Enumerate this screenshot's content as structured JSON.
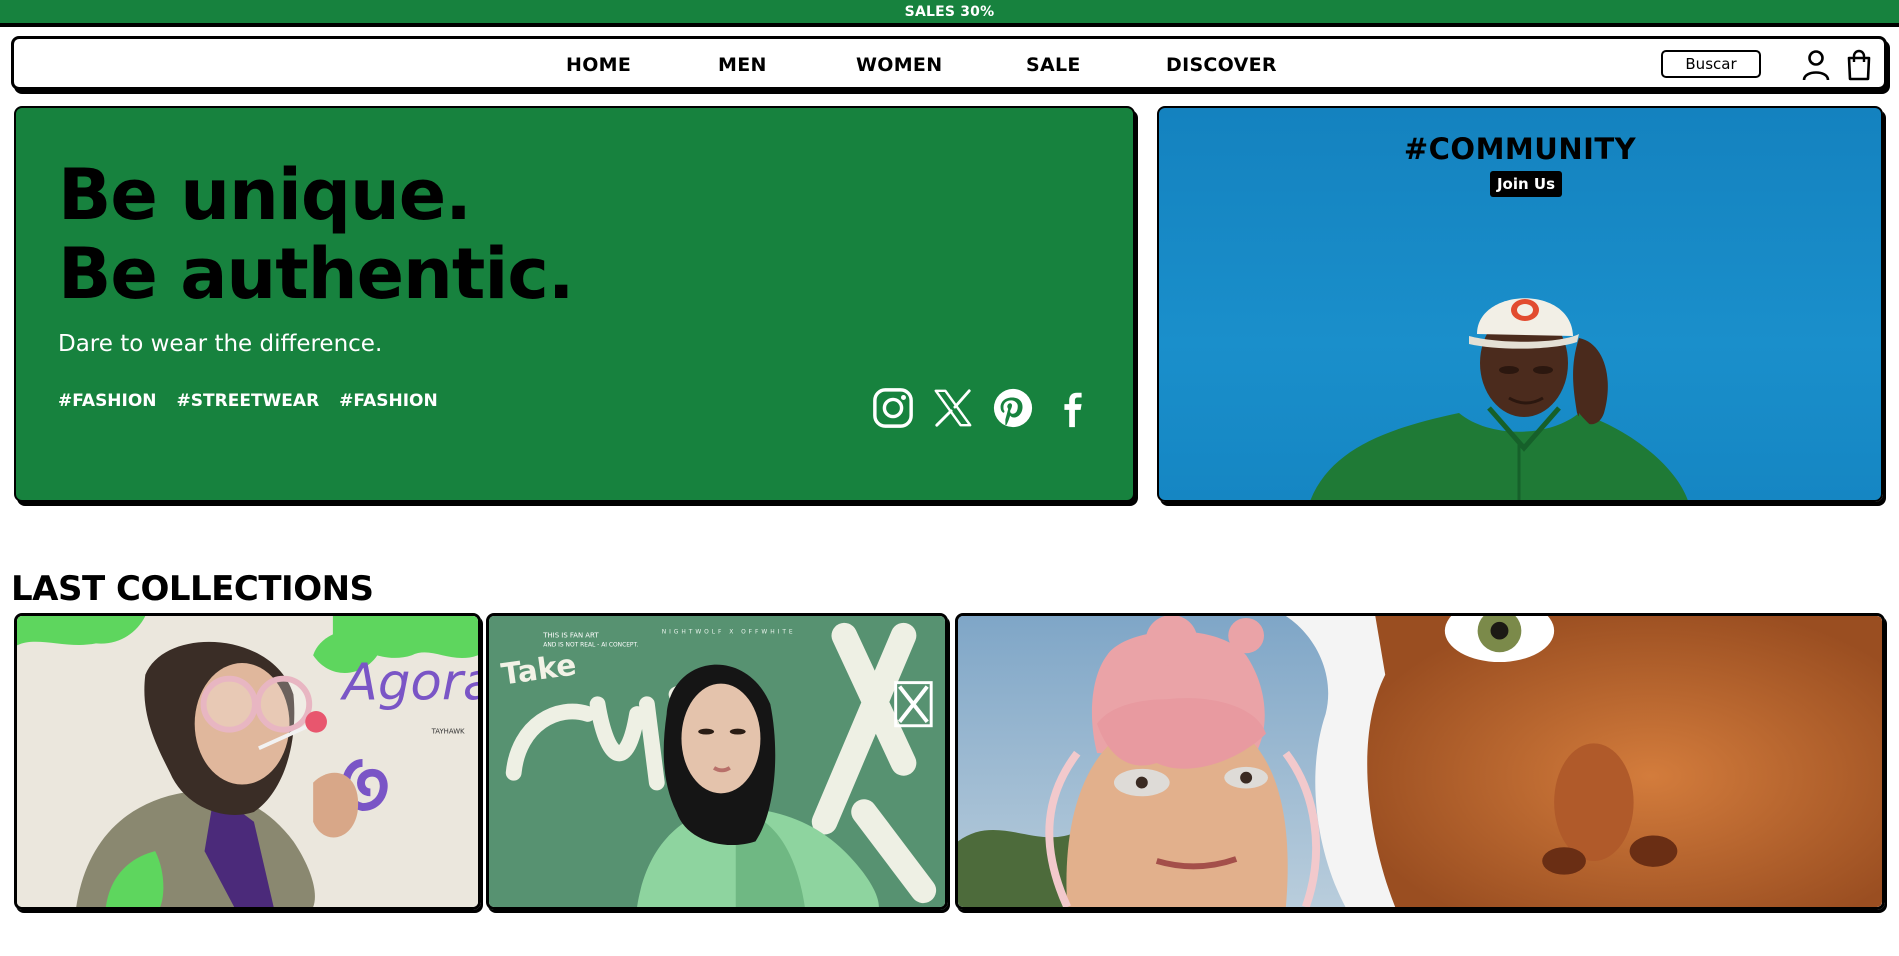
{
  "promo": {
    "text": "SALES 30%"
  },
  "nav": {
    "links": [
      "HOME",
      "MEN",
      "WOMEN",
      "SALE",
      "DISCOVER"
    ],
    "search_label": "Buscar",
    "icons": [
      "user-icon",
      "shopping-bag-icon"
    ]
  },
  "hero": {
    "title_line1": "Be unique.",
    "title_line2": "Be authentic.",
    "subtitle": "Dare to wear the difference.",
    "hashtags": [
      "#FASHION",
      "#STREETWEAR",
      "#FASHION"
    ],
    "socials": [
      "instagram-icon",
      "x-icon",
      "pinterest-icon",
      "facebook-icon"
    ]
  },
  "community": {
    "title": "#COMMUNITY",
    "button": "Join Us"
  },
  "collections": {
    "title": "LAST COLLECTIONS",
    "card2_text": {
      "take": "Take",
      "fanart": "THIS IS FAN ART",
      "disclaimer": "AND IS NOT REAL - AI CONCEPT.",
      "collab": "NIGHTWOLF X OFFWHITE"
    },
    "card1_text": {
      "agora": "Agora!",
      "tayhawk": "TAYHAWK"
    }
  },
  "colors": {
    "brand_green": "#17823e",
    "community_blue": "#1a8fcb",
    "black": "#000000",
    "white": "#ffffff"
  }
}
